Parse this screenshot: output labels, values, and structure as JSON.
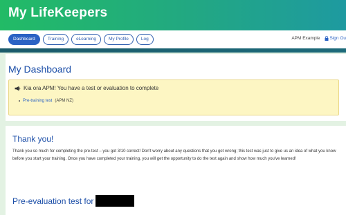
{
  "app": {
    "title": "My LifeKeepers"
  },
  "nav": {
    "tabs": [
      {
        "label": "Dashboard",
        "active": true
      },
      {
        "label": "Training",
        "active": false
      },
      {
        "label": "eLearning",
        "active": false
      },
      {
        "label": "My Profile",
        "active": false
      },
      {
        "label": "Log",
        "active": false
      }
    ],
    "user": "APM Example",
    "signout_label": "Sign Ou"
  },
  "dashboard": {
    "title": "My Dashboard",
    "alert": {
      "message": "Kia ora APM! You have a test or evaluation to complete",
      "items": [
        {
          "link": "Pre-training test",
          "suffix": "(APM NZ)"
        }
      ]
    }
  },
  "thankyou": {
    "title": "Thank you!",
    "body": "Thank you so much for completing the pre-test – you got 3/10 correct! Don't worry about any questions that you got wrong; this test was just to give us an idea of what you know before you start your training. Once you have completed your training, you will get the opportunity to do the test again and show how much you've learned!",
    "pre_eval_title": "Pre-evaluation test for"
  },
  "colors": {
    "header_start": "#22bb66",
    "header_end": "#1e9aa0",
    "accent_blue": "#2a62c4",
    "alert_bg": "#fdf6c3"
  },
  "icons": {
    "alert": "megaphone-icon",
    "signout": "lock-icon"
  }
}
